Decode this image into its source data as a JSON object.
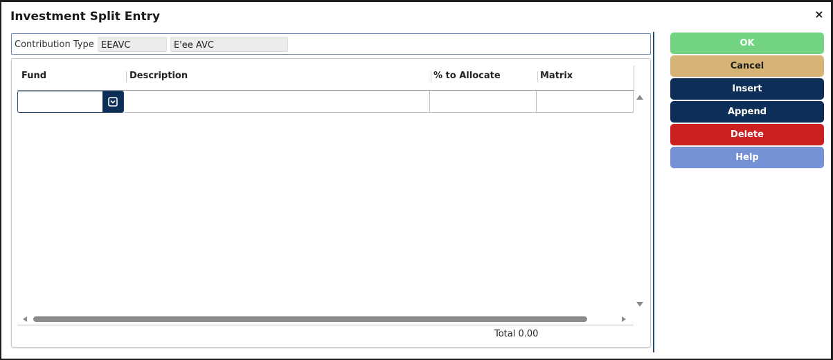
{
  "dialog": {
    "title": "Investment Split Entry",
    "close_glyph": "×"
  },
  "contribution": {
    "label": "Contribution Type",
    "code": "EEAVC",
    "description": "E'ee AVC"
  },
  "grid": {
    "columns": [
      "Fund",
      "Description",
      "% to Allocate",
      "Matrix"
    ],
    "rows": [
      {
        "fund": "",
        "description": "",
        "allocate": "",
        "matrix": ""
      }
    ],
    "total_label": "Total 0.00"
  },
  "buttons": {
    "ok": "OK",
    "cancel": "Cancel",
    "insert": "Insert",
    "append": "Append",
    "delete": "Delete",
    "help": "Help"
  },
  "icons": {
    "fund_dropdown": "chevron-down-box-icon",
    "close": "close-icon"
  },
  "colors": {
    "ok": "#72d483",
    "cancel": "#d6b475",
    "primary": "#0d2f57",
    "delete": "#cc1f1f",
    "help": "#7592d6"
  }
}
